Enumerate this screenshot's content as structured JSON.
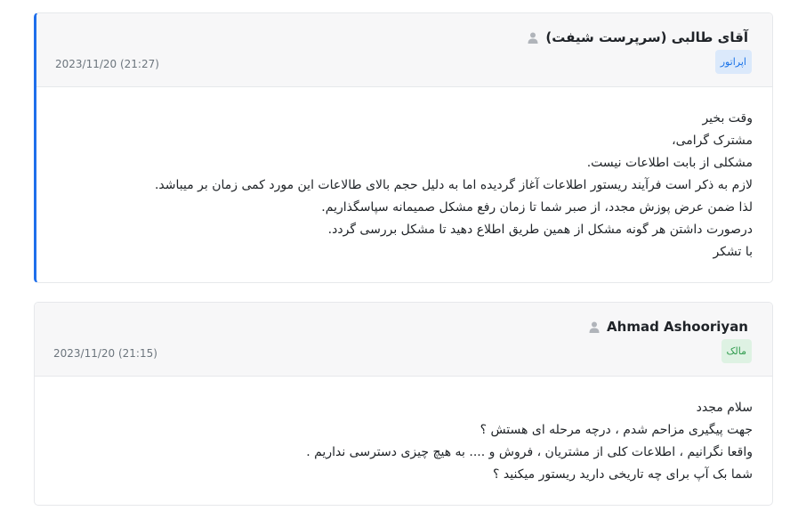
{
  "messages": [
    {
      "author": "آقای طالبی (سرپرست شیفت)",
      "role": "اپراتور",
      "datetime": "2023/11/20 (21:27)",
      "lines": [
        "وقت بخیر",
        "مشترک گرامی،",
        "مشکلی از بابت اطلاعات نیست.",
        "لازم به ذکر است فرآیند ریستور اطلاعات آغاز گردیده اما به دلیل حجم بالای طالاعات این مورد کمی زمان بر میباشد.",
        "لذا ضمن عرض پوزش مجدد، از صبر شما تا زمان رفع مشکل صمیمانه سپاسگذاریم.",
        "درصورت داشتن هر گونه مشکل از همین طریق اطلاع دهید تا مشکل بررسی گردد.",
        "با تشکر"
      ]
    },
    {
      "author": "Ahmad Ashooriyan",
      "role": "مالک",
      "datetime": "2023/11/20 (21:15)",
      "lines": [
        "سلام مجدد",
        "جهت پیگیری مزاحم شدم ، درچه مرحله ای هستش ؟",
        "واقعا نگرانیم ، اطلاعات کلی از مشتریان ، فروش و .... به هیچ چیزی دسترسی نداریم .",
        "شما بک آپ برای چه تاریخی دارید ریستور میکنید ؟"
      ]
    }
  ],
  "colors": {
    "operator_accent": "#1f6feb",
    "operator_badge_bg": "#dbe9fb",
    "operator_badge_text": "#1a73e8",
    "owner_badge_bg": "#def2e3",
    "owner_badge_text": "#2e9a4c"
  },
  "icons": {
    "author": "person-icon"
  }
}
